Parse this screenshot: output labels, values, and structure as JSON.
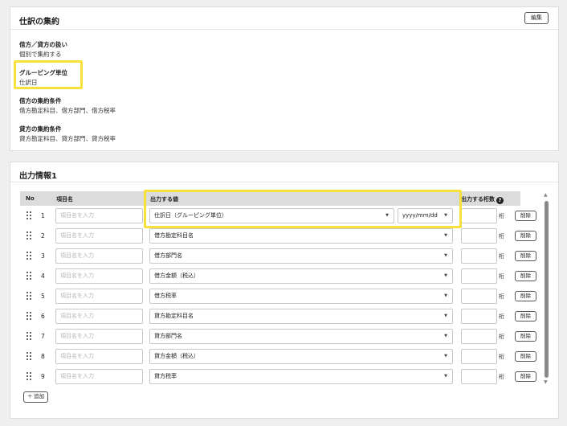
{
  "summary": {
    "title": "仕訳の集約",
    "edit_label": "編集",
    "fields": [
      {
        "label": "借方／貸方の扱い",
        "value": "個別で集約する"
      },
      {
        "label": "グルーピング単位",
        "value": "仕訳日"
      },
      {
        "label": "借方の集約条件",
        "value": "借方勘定科目、借方部門、借方税率"
      },
      {
        "label": "貸方の集約条件",
        "value": "貸方勘定科目、貸方部門、貸方税率"
      }
    ]
  },
  "output": {
    "title": "出力情報1",
    "columns": {
      "no": "No",
      "item_name": "項目名",
      "output_value": "出力する値",
      "digits": "出力する桁数"
    },
    "item_placeholder": "項目名を入力",
    "digits_unit": "桁",
    "delete_label": "削除",
    "add_label": "＋ 追加",
    "rows": [
      {
        "no": "1",
        "value": "仕訳日（グルーピング単位）",
        "format": "yyyy/mm/dd"
      },
      {
        "no": "2",
        "value": "借方勘定科目名"
      },
      {
        "no": "3",
        "value": "借方部門名"
      },
      {
        "no": "4",
        "value": "借方金額（税込）"
      },
      {
        "no": "5",
        "value": "借方税率"
      },
      {
        "no": "6",
        "value": "貸方勘定科目名"
      },
      {
        "no": "7",
        "value": "貸方部門名"
      },
      {
        "no": "8",
        "value": "貸方金額（税込）"
      },
      {
        "no": "9",
        "value": "貸方税率"
      }
    ]
  },
  "colors": {
    "highlight": "#f7e23b",
    "header_bg": "#dcdcdc",
    "page_bg": "#efefef"
  },
  "icons": {
    "help": "?",
    "caret": "▼",
    "scroll_up": "▲",
    "scroll_down": "▼"
  }
}
